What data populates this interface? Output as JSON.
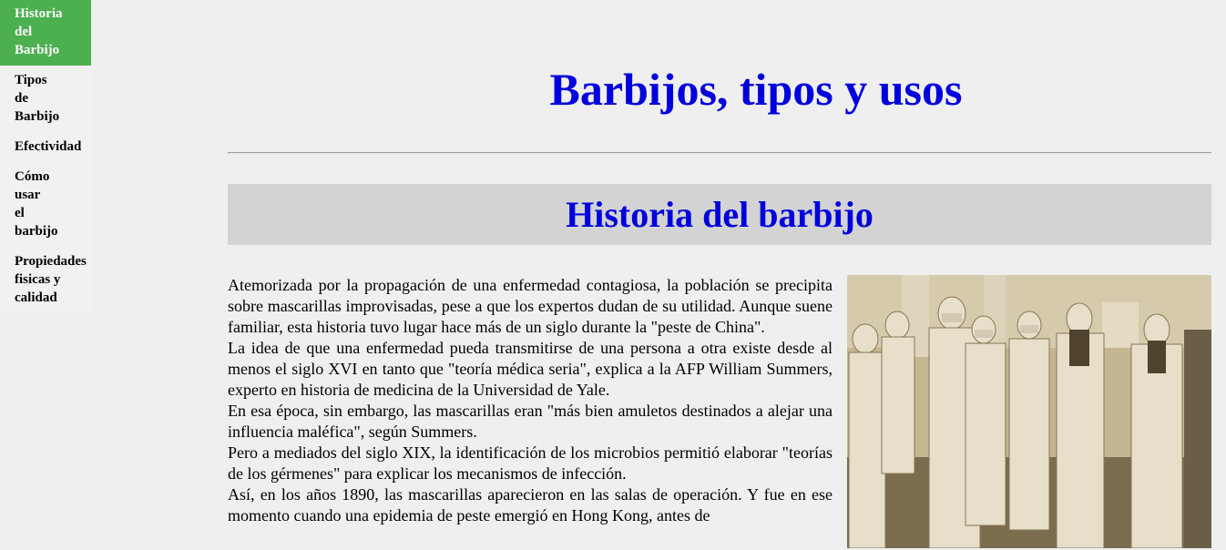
{
  "sidebar": {
    "items": [
      {
        "label": "Historia del Barbijo",
        "active": true
      },
      {
        "label": "Tipos de Barbijo"
      },
      {
        "label": "Efectividad"
      },
      {
        "label": "Cómo usar el barbijo"
      },
      {
        "label": "Propiedades fisicas y calidad"
      }
    ]
  },
  "main": {
    "title": "Barbijos, tipos y usos",
    "section_title": "Historia del barbijo",
    "paragraphs": [
      "Atemorizada por la propagación de una enfermedad contagiosa, la población se precipita sobre mascarillas improvisadas, pese a que los expertos dudan de su utilidad. Aunque suene familiar, esta historia tuvo lugar hace más de un siglo durante la \"peste de China\".",
      "La idea de que una enfermedad pueda transmitirse de una persona a otra existe desde al menos el siglo XVI en tanto que \"teoría médica seria\", explica a la AFP William Summers, experto en historia de medicina de la Universidad de Yale.",
      "En esa época, sin embargo, las mascarillas eran \"más bien amuletos destinados a alejar una influencia maléfica\", según Summers.",
      "Pero a mediados del siglo XIX, la identificación de los microbios permitió elaborar \"teorías de los gérmenes\" para explicar los mecanismos de infección.",
      "Así, en los años 1890, las mascarillas aparecieron en las salas de operación. Y fue en ese momento cuando una epidemia de peste emergió en Hong Kong, antes de"
    ]
  }
}
